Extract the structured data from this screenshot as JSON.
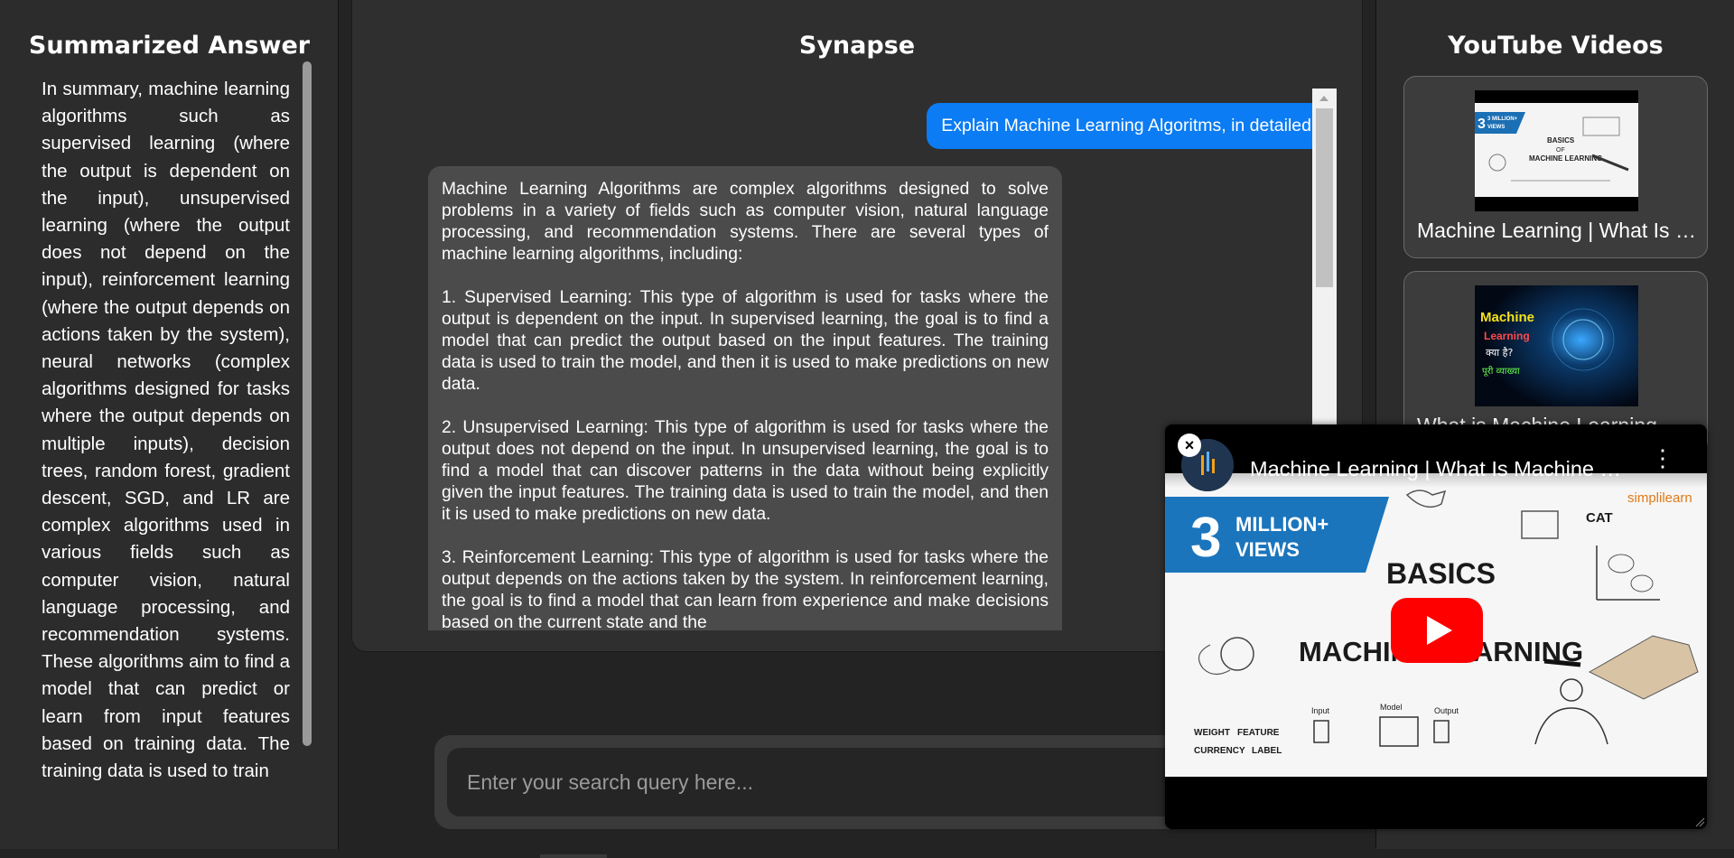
{
  "left_panel": {
    "title": "Summarized Answer",
    "summary": "In summary, machine learning algorithms such as supervised learning (where the output is dependent on the input), unsupervised learning (where the output does not depend on the input), reinforcement learning (where the output depends on actions taken by the system), neural networks (complex algorithms designed for tasks where the output depends on multiple inputs), decision trees, random forest, gradient descent, SGD, and LR are complex algorithms used in various fields such as computer vision, natural language processing, and recommendation systems. These algorithms aim to find a model that can predict or learn from input features based on training data. The training data is used to train"
  },
  "center_panel": {
    "title": "Synapse",
    "user_message": "Explain Machine Learning Algoritms, in detailed",
    "bot_paragraphs": [
      "Machine Learning Algorithms are complex algorithms designed to solve problems in a variety of fields such as computer vision, natural language processing, and recommendation systems. There are several types of machine learning algorithms, including:",
      "1. Supervised Learning: This type of algorithm is used for tasks where the output is dependent on the input. In supervised learning, the goal is to find a model that can predict the output based on the input features. The training data is used to train the model, and then it is used to make predictions on new data.",
      "2. Unsupervised Learning: This type of algorithm is used for tasks where the output does not depend on the input. In unsupervised learning, the goal is to find a model that can discover patterns in the data without being explicitly given the input features. The training data is used to train the model, and then it is used to make predictions on new data.",
      "3. Reinforcement Learning: This type of algorithm is used for tasks where the output depends on the actions taken by the system. In reinforcement learning, the goal is to find a model that can learn from experience and make decisions based on the current state and the"
    ]
  },
  "search": {
    "placeholder": "Enter your search query here...",
    "value": ""
  },
  "right_panel": {
    "title": "YouTube Videos",
    "videos": [
      {
        "title": "Machine Learning | What Is Machine Learning?",
        "thumb_lines": [
          "3 MILLION+",
          "VIEWS",
          "BASICS",
          "OF",
          "MACHINE LEARNING"
        ]
      },
      {
        "title": "What is Machine Learning",
        "thumb_lines": [
          "Machine",
          "Learning",
          "क्या है?",
          "पूरी व्याख्या"
        ]
      }
    ]
  },
  "mini_player": {
    "title": "Machine Learning | What Is Machine Learning?",
    "close_label": "×",
    "more_label": "⋮",
    "thumb_banner_top": "MILLION+",
    "thumb_banner_bottom": "VIEWS",
    "thumb_banner_number": "3",
    "thumb_basics": "BASICS",
    "thumb_ml": "MACHINE LEARNING",
    "thumb_brand": "simplilearn",
    "thumb_cat": "CAT",
    "thumb_weight": "WEIGHT",
    "thumb_feature": "FEATURE",
    "thumb_currency": "CURRENCY",
    "thumb_label": "LABEL",
    "thumb_input": "Input",
    "thumb_model": "Model",
    "thumb_output": "Output"
  },
  "colors": {
    "user_bubble": "#0b7cf3",
    "bot_bubble": "#4b4b4b",
    "panel_bg": "#2c2c2c",
    "page_bg": "#232323",
    "youtube_red": "#ff0000"
  }
}
